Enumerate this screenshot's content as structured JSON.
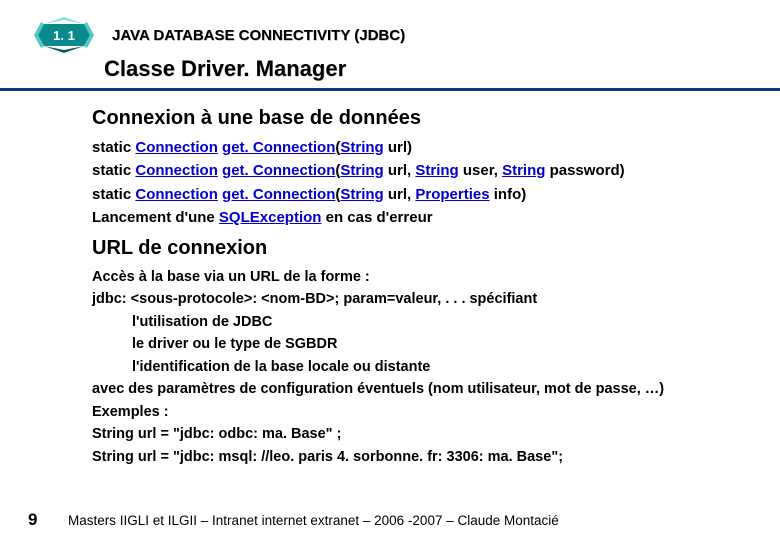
{
  "header": {
    "section_number": "1. 1",
    "title": "JAVA DATABASE CONNECTIVITY (JDBC)",
    "subtitle": "Classe Driver. Manager"
  },
  "section1": {
    "heading": "Connexion à une base de données",
    "sig1": {
      "p0": "static ",
      "p1": "Connection",
      "p2": " ",
      "p3": "get. Connection",
      "p4": "(",
      "p5": "String",
      "p6": " url)"
    },
    "sig2": {
      "p0": "static ",
      "p1": "Connection",
      "p2": " ",
      "p3": "get. Connection",
      "p4": "(",
      "p5": "String",
      "p6": " url, ",
      "p7": "String",
      "p8": " user, ",
      "p9": "String",
      "p10": " password)"
    },
    "sig3": {
      "p0": "static ",
      "p1": "Connection",
      "p2": " ",
      "p3": "get. Connection",
      "p4": "(",
      "p5": "String",
      "p6": " url, ",
      "p7": "Properties",
      "p8": " info)"
    },
    "exc": {
      "p0": "Lancement d'une ",
      "p1": "SQLException",
      "p2": " en cas d'erreur"
    }
  },
  "section2": {
    "heading": "URL de connexion",
    "lines": [
      "Accès à la base via un URL de la forme :",
      "jdbc: <sous-protocole>: <nom-BD>; param=valeur, . . . spécifiant",
      "l'utilisation de JDBC",
      "le driver ou le type de SGBDR",
      "l'identification de la base locale ou distante",
      "avec des paramètres de configuration éventuels (nom utilisateur, mot de passe, …)",
      "Exemples :",
      "String url = \"jdbc: odbc: ma. Base\" ;",
      "String url = \"jdbc: msql: //leo. paris 4. sorbonne. fr: 3306: ma. Base\";"
    ]
  },
  "footer": {
    "page": "9",
    "text": "Masters IIGLI et ILGII – Intranet internet extranet – 2006 -2007 – Claude Montacié"
  }
}
